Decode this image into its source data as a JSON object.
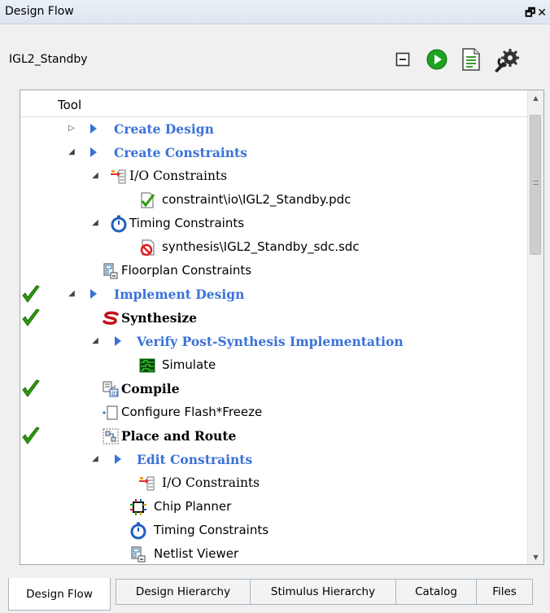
{
  "window": {
    "title": "Design Flow",
    "float_icon": "restore-icon",
    "close_icon": "close-icon"
  },
  "project": {
    "name": "IGL2_Standby"
  },
  "toolbar": [
    {
      "name": "collapse-all-button",
      "icon": "collapse-icon"
    },
    {
      "name": "run-button",
      "icon": "play-icon"
    },
    {
      "name": "report-button",
      "icon": "report-icon"
    },
    {
      "name": "configure-button",
      "icon": "wrench-gear-icon"
    }
  ],
  "tree": {
    "column_header": "Tool",
    "rows": [
      {
        "label": "Create Design",
        "style": "cat",
        "expander": "collapsed",
        "check": false
      },
      {
        "label": "Create Constraints",
        "style": "cat",
        "expander": "expanded",
        "check": false
      },
      {
        "label": "I/O Constraints",
        "style": "serif",
        "expander": "expanded",
        "icon": "io-constraints-icon",
        "check": false
      },
      {
        "label": "constraint\\io\\IGL2_Standby.pdc",
        "style": "plain",
        "icon": "pdc-file-icon",
        "check": false
      },
      {
        "label": "Timing Constraints",
        "style": "plain",
        "expander": "expanded",
        "icon": "stopwatch-icon",
        "check": false
      },
      {
        "label": "synthesis\\IGL2_Standby_sdc.sdc",
        "style": "plain",
        "icon": "sdc-file-error-icon",
        "check": false
      },
      {
        "label": "Floorplan Constraints",
        "style": "plain",
        "icon": "floorplan-icon",
        "check": false
      },
      {
        "label": "Implement Design",
        "style": "cat",
        "expander": "expanded",
        "check": true
      },
      {
        "label": "Synthesize",
        "style": "bold",
        "icon": "synplify-icon",
        "check": true
      },
      {
        "label": "Verify Post-Synthesis Implementation",
        "style": "cat",
        "expander": "expanded",
        "check": false
      },
      {
        "label": "Simulate",
        "style": "plain",
        "icon": "waveform-icon",
        "check": false
      },
      {
        "label": "Compile",
        "style": "bold",
        "icon": "compile-icon",
        "check": true
      },
      {
        "label": "Configure Flash*Freeze",
        "style": "plain",
        "icon": "flash-freeze-icon",
        "check": false
      },
      {
        "label": "Place and Route",
        "style": "bold",
        "icon": "place-route-icon",
        "check": true
      },
      {
        "label": "Edit Constraints",
        "style": "cat",
        "expander": "expanded",
        "check": false
      },
      {
        "label": "I/O Constraints",
        "style": "serif",
        "icon": "io-constraints-icon",
        "check": false
      },
      {
        "label": "Chip Planner",
        "style": "plain",
        "icon": "chip-planner-icon",
        "check": false
      },
      {
        "label": "Timing Constraints",
        "style": "plain",
        "icon": "stopwatch-icon",
        "check": false
      },
      {
        "label": "Netlist Viewer",
        "style": "plain",
        "icon": "netlist-viewer-icon",
        "check": false
      }
    ]
  },
  "tabs": [
    {
      "label": "Design Flow",
      "active": true
    },
    {
      "label": "Design Hierarchy",
      "active": false
    },
    {
      "label": "Stimulus Hierarchy",
      "active": false
    },
    {
      "label": "Catalog",
      "active": false
    },
    {
      "label": "Files",
      "active": false
    }
  ],
  "colors": {
    "category_blue": "#3a72d8",
    "check_green": "#2e9b0c",
    "play_green": "#1ea31e"
  }
}
